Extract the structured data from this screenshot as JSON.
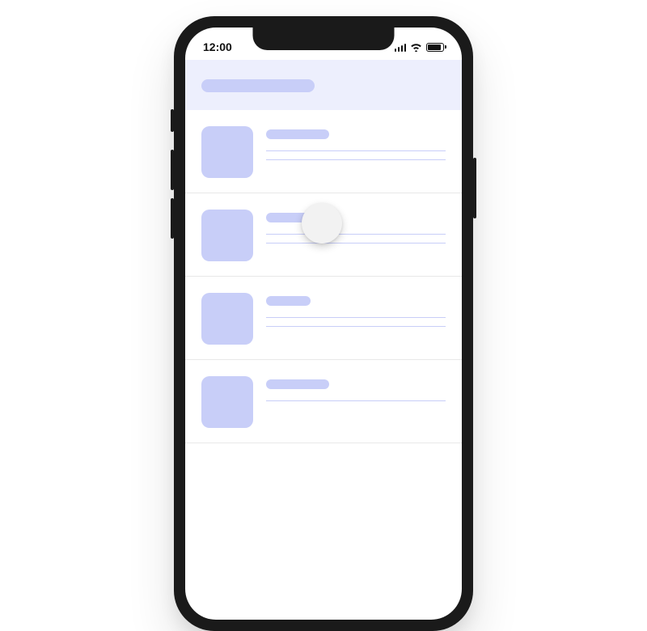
{
  "status_bar": {
    "time": "12:00"
  },
  "colors": {
    "skeleton": "#c8cef8",
    "header_bg": "#edeffd"
  }
}
